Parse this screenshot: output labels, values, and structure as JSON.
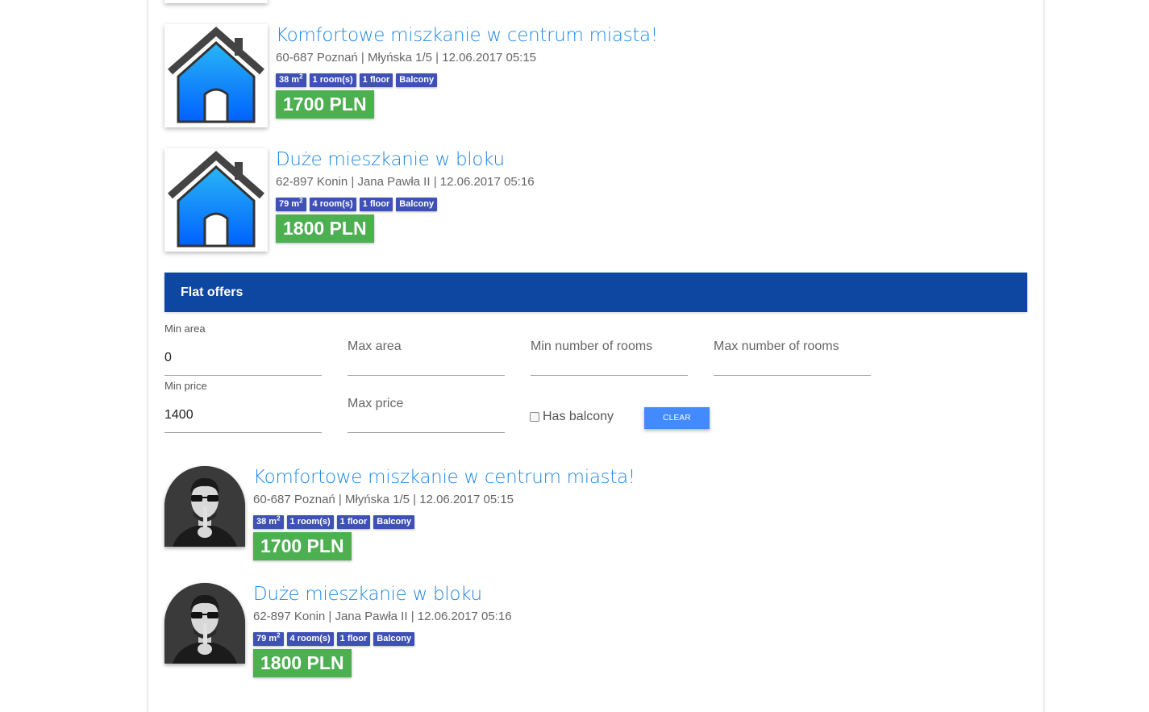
{
  "colors": {
    "title_link": "#1e88e5",
    "badge": "#3f51b5",
    "price": "#4caf50",
    "header": "#0d47a1",
    "button": "#448aff"
  },
  "offers_top": [
    {
      "image": "house-icon",
      "title": "Komfortowe miszkanie w centrum miasta!",
      "meta": "60-687 Poznań | Młyńska 1/5 | 12.06.2017 05:15",
      "area": "38 m",
      "area_sup": "2",
      "rooms": "1 room(s)",
      "floor": "1 floor",
      "balcony": "Balcony",
      "price": "1700 PLN"
    },
    {
      "image": "house-icon",
      "title": "Duże mieszkanie w bloku",
      "meta": "62-897 Konin | Jana Pawła II | 12.06.2017 05:16",
      "area": "79 m",
      "area_sup": "2",
      "rooms": "4 room(s)",
      "floor": "1 floor",
      "balcony": "Balcony",
      "price": "1800 PLN"
    }
  ],
  "panel": {
    "title": "Flat offers"
  },
  "filters": {
    "min_area": {
      "label": "Min area",
      "value": "0"
    },
    "max_area": {
      "placeholder": "Max area"
    },
    "min_rooms": {
      "placeholder": "Min number of rooms"
    },
    "max_rooms": {
      "placeholder": "Max number of rooms"
    },
    "min_price": {
      "label": "Min price",
      "value": "1400"
    },
    "max_price": {
      "placeholder": "Max price"
    },
    "has_balcony": {
      "label": "Has balcony",
      "checked": false
    },
    "clear_label": "Clear"
  },
  "offers_bottom": [
    {
      "image": "person-avatar",
      "title": "Komfortowe miszkanie w centrum miasta!",
      "meta": "60-687 Poznań | Młyńska 1/5 | 12.06.2017 05:15",
      "area": "38 m",
      "area_sup": "2",
      "rooms": "1 room(s)",
      "floor": "1 floor",
      "balcony": "Balcony",
      "price": "1700 PLN"
    },
    {
      "image": "person-avatar",
      "title": "Duże mieszkanie w bloku",
      "meta": "62-897 Konin | Jana Pawła II | 12.06.2017 05:16",
      "area": "79 m",
      "area_sup": "2",
      "rooms": "4 room(s)",
      "floor": "1 floor",
      "balcony": "Balcony",
      "price": "1800 PLN"
    }
  ]
}
